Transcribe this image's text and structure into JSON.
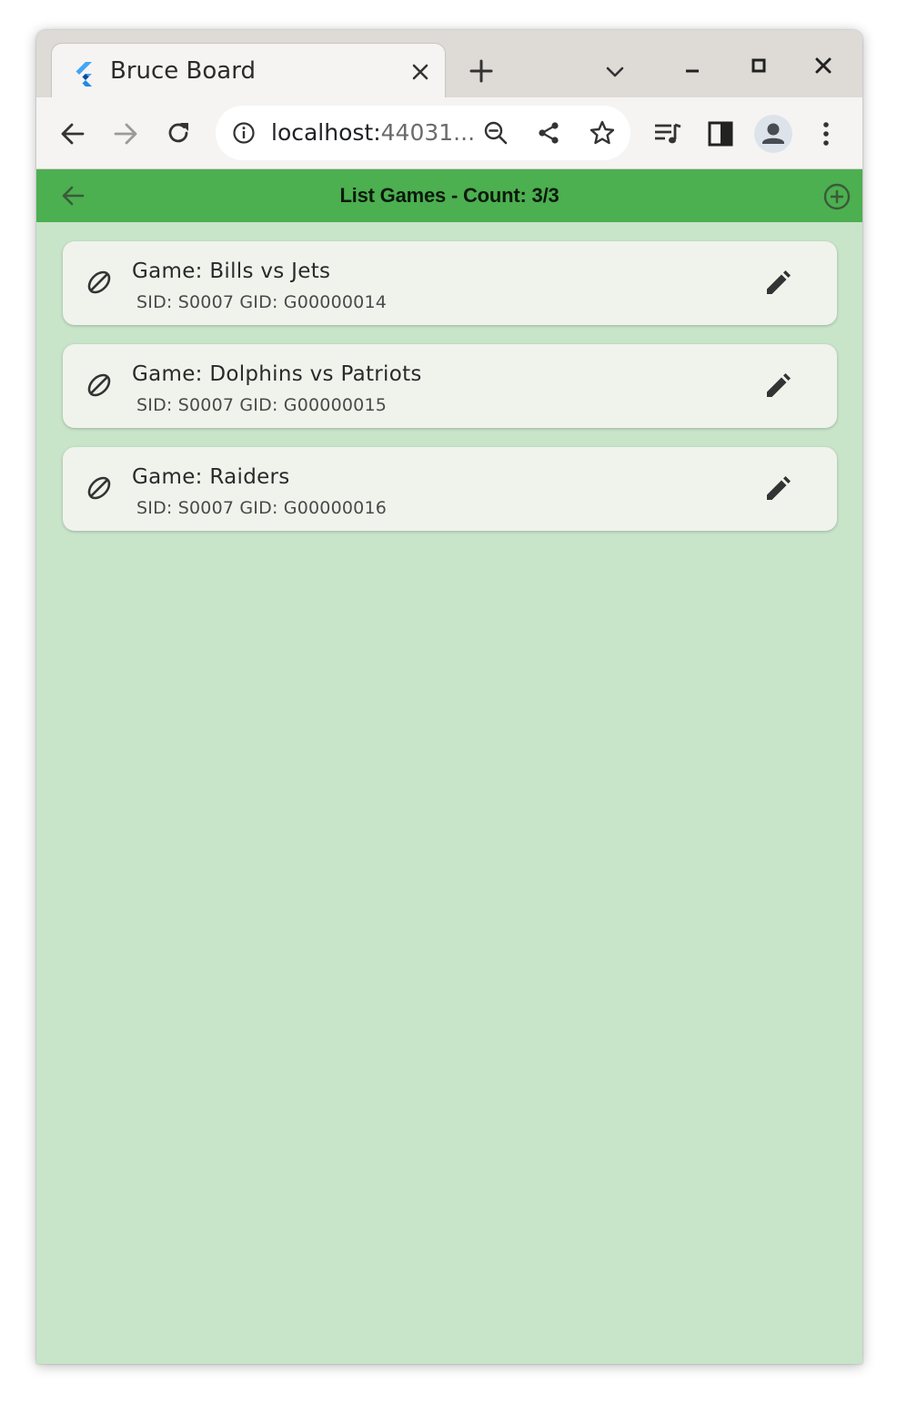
{
  "browser": {
    "tab_title": "Bruce Board",
    "url_host": "localhost:",
    "url_rest": "44031..."
  },
  "appbar": {
    "title": "List Games - Count: 3/3",
    "color": "#4caf50"
  },
  "background_color": "#c8e4c9",
  "games": [
    {
      "title": "Game: Bills vs Jets",
      "subtitle": "SID: S0007 GID: G00000014"
    },
    {
      "title": "Game: Dolphins vs Patriots",
      "subtitle": "SID: S0007 GID: G00000015"
    },
    {
      "title": "Game: Raiders",
      "subtitle": "SID: S0007 GID: G00000016"
    }
  ],
  "icons": {
    "leading": "football-icon",
    "trailing": "edit-pencil-icon"
  }
}
